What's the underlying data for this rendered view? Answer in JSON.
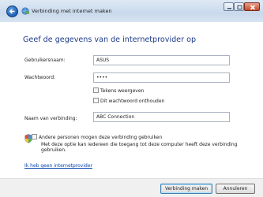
{
  "window": {
    "title": "Verbinding met internet maken",
    "controls": {
      "minimize": "minimize",
      "maximize": "maximize",
      "close": "close"
    }
  },
  "main": {
    "heading": "Geef de gegevens van de internetprovider op",
    "username_label": "Gebruikersnaam:",
    "username_value": "ASUS",
    "password_label": "Wachtwoord:",
    "password_value": "••••",
    "show_chars_label": "Tekens weergeven",
    "remember_password_label": "Dit wachtwoord onthouden",
    "connection_name_label": "Naam van verbinding:",
    "connection_name_value": "ABC Connection",
    "allow_others_label": "Andere personen mogen deze verbinding gebruiken",
    "allow_others_desc": "Met deze optie kan iedereen die toegang tot deze computer heeft deze verbinding gebruiken.",
    "no_provider_link": "Ik heb geen internetprovider"
  },
  "footer": {
    "connect_button": "Verbinding maken",
    "cancel_button": "Annuleren"
  },
  "colors": {
    "heading": "#1f3b8a",
    "link": "#0645ad",
    "titlebar": "#c9d9ec"
  },
  "icons": [
    "back-arrow-icon",
    "network-icon",
    "shield-icon"
  ]
}
